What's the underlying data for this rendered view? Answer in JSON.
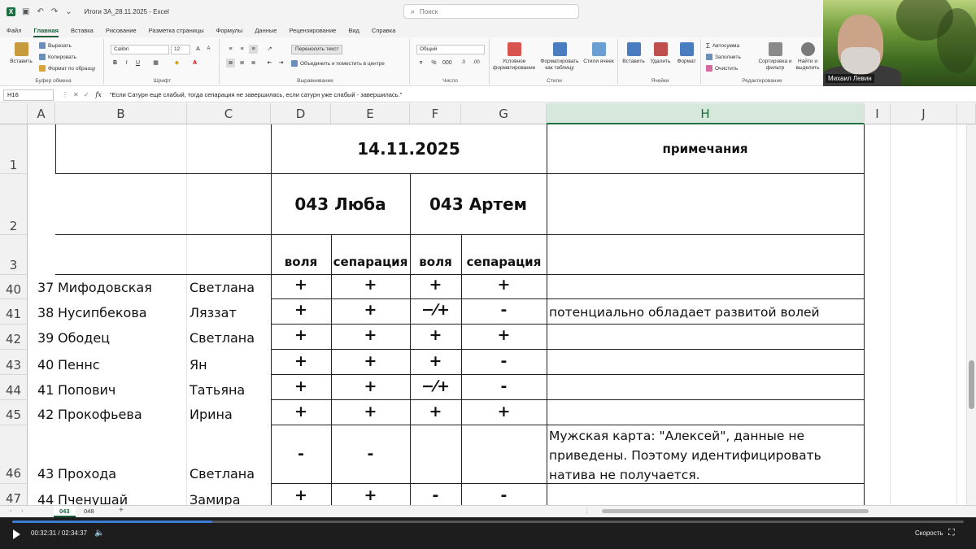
{
  "window": {
    "title": "Итоги ЗА_28.11.2025  -  Excel",
    "search_placeholder": "Поиск"
  },
  "menu": [
    "Файл",
    "Главная",
    "Вставка",
    "Рисование",
    "Разметка страницы",
    "Формулы",
    "Данные",
    "Рецензирование",
    "Вид",
    "Справка"
  ],
  "ribbon": {
    "paste": "Вставить",
    "cut": "Вырезать",
    "copy": "Копировать",
    "format_painter": "Формат по образцу",
    "clipboard_label": "Буфер обмена",
    "font_name": "Calibri",
    "font_size": "12",
    "font_label": "Шрифт",
    "wrap_text": "Переносить текст",
    "merge_center": "Объединить и поместить в центре",
    "alignment_label": "Выравнивание",
    "number_format": "Общий",
    "number_label": "Число",
    "conditional_formatting": "Условное форматирование",
    "format_as_table": "Форматировать как таблицу",
    "cell_styles": "Стили ячеек",
    "styles_label": "Стили",
    "insert": "Вставить",
    "delete": "Удалить",
    "format": "Формат",
    "cells_label": "Ячейки",
    "autosum": "Автосумма",
    "fill": "Заполнить",
    "clear": "Очистить",
    "sort_filter": "Сортировка и фильтр",
    "find_select": "Найти и выделить",
    "editing_label": "Редактирование"
  },
  "formula_bar": {
    "name_box": "H16",
    "fx": "fx",
    "formula": "\"Если Сатурн ещё слабый, тогда сепарация не завершилась, если сатурн уже слабый - завершилась.\""
  },
  "webcam": {
    "name": "Михаил Левин"
  },
  "sheet": {
    "columns": [
      "A",
      "B",
      "C",
      "D",
      "E",
      "F",
      "G",
      "H",
      "I",
      "J"
    ],
    "selected_column": "H",
    "header": {
      "date": "14.11.2025",
      "notes_title": "примечания",
      "group1": "043 Люба",
      "group2": "043 Артем",
      "sub": [
        "воля",
        "сепарация",
        "воля",
        "сепарация"
      ]
    },
    "row_headers": [
      "1",
      "2",
      "3"
    ],
    "rows": [
      {
        "row": "40",
        "n": "37",
        "last": "Мифодовская",
        "first": "Светлана",
        "d": "+",
        "e": "+",
        "f": "+",
        "g": "+",
        "note": ""
      },
      {
        "row": "41",
        "n": "38",
        "last": "Нусипбекова",
        "first": "Ляззат",
        "d": "+",
        "e": "+",
        "f": "−⁄+",
        "g": "-",
        "note": "потенциально обладает развитой волей"
      },
      {
        "row": "42",
        "n": "39",
        "last": "Ободец",
        "first": "Светлана",
        "d": "+",
        "e": "+",
        "f": "+",
        "g": "+",
        "note": ""
      },
      {
        "row": "43",
        "n": "40",
        "last": "Пеннс",
        "first": "Ян",
        "d": "+",
        "e": "+",
        "f": "+",
        "g": "-",
        "note": ""
      },
      {
        "row": "44",
        "n": "41",
        "last": "Попович",
        "first": "Татьяна",
        "d": "+",
        "e": "+",
        "f": "−⁄+",
        "g": "-",
        "note": ""
      },
      {
        "row": "45",
        "n": "42",
        "last": "Прокофьева",
        "first": "Ирина",
        "d": "+",
        "e": "+",
        "f": "+",
        "g": "+",
        "note": ""
      },
      {
        "row": "46",
        "n": "43",
        "last": "Прохода",
        "first": "Светлана",
        "d": "-",
        "e": "-",
        "f": "",
        "g": "",
        "note": "Мужская карта: \"Алексей\", данные не приведены. Поэтому идентифицировать натива не получается."
      },
      {
        "row": "47",
        "n": "44",
        "last": "Пченушай",
        "first": "Замира",
        "d": "+",
        "e": "+",
        "f": "-",
        "g": "-",
        "note": ""
      }
    ]
  },
  "sheet_tabs": [
    "043",
    "048"
  ],
  "player": {
    "current_time": "00:32:31",
    "total_time": "02:34:37",
    "progress": 0.21,
    "speed_label": "Скорость"
  },
  "colors": {
    "excel_green": "#217346",
    "header_gray": "#f1f1f1",
    "player_bg": "#1d1d1d",
    "progress_blue": "#3d7bd8"
  }
}
